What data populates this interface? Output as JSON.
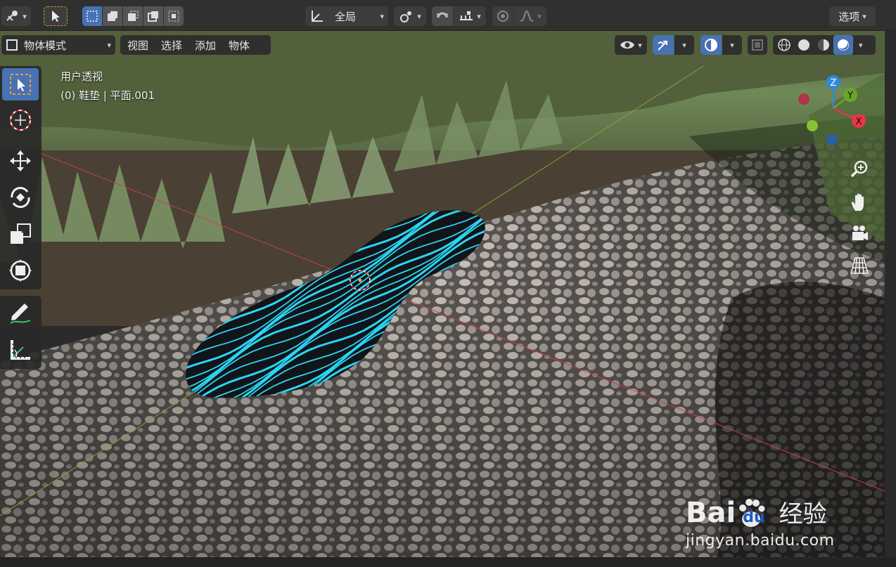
{
  "header": {
    "transform_pivot_label": "全局",
    "options_label": "选项"
  },
  "viewport_header": {
    "mode_label": "物体模式",
    "menus": [
      "视图",
      "选择",
      "添加",
      "物体"
    ]
  },
  "viewport_overlay": {
    "view_name": "用户透视",
    "object_info": "(0) 鞋垫 | 平面.001"
  },
  "gizmo": {
    "axes": [
      "Z",
      "Y",
      "X"
    ],
    "colors": {
      "x": "#e8344a",
      "y": "#6aa52a",
      "z": "#2e8ad8",
      "x_neg": "#b0344a",
      "y_neg": "#86c232",
      "z_neg": "#2a5fa0"
    }
  },
  "watermark": {
    "brand": "Bai",
    "brand_du": "du",
    "product": "经验",
    "url": "jingyan.baidu.com"
  },
  "colors": {
    "accent_blue": "#4772b3",
    "insole_stripe": "#2ad6f5",
    "insole_base": "#111418"
  }
}
